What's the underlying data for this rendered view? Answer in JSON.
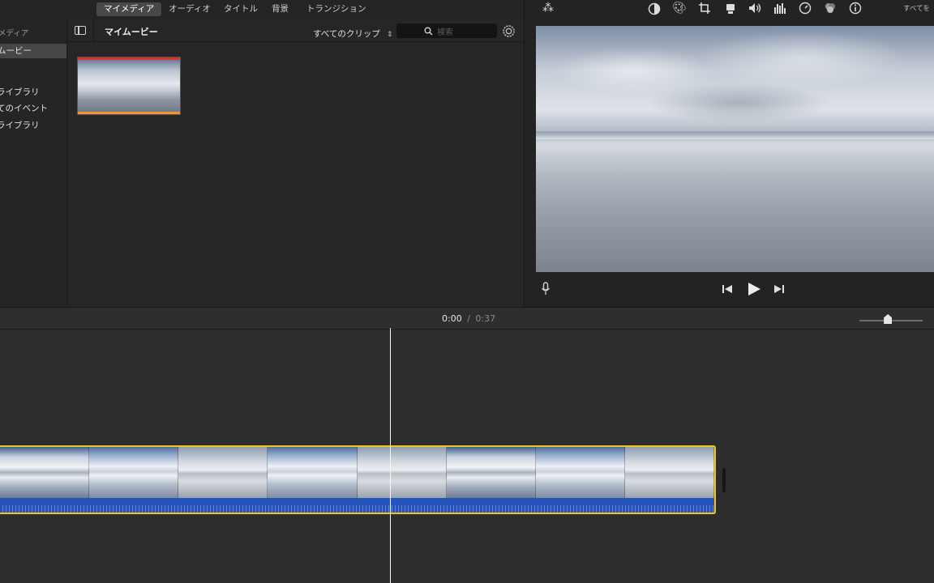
{
  "tabs": [
    {
      "label": "マイメディア",
      "active": true
    },
    {
      "label": "オーディオ",
      "active": false
    },
    {
      "label": "タイトル",
      "active": false
    },
    {
      "label": "背景",
      "active": false
    },
    {
      "label": "トランジション",
      "active": false
    }
  ],
  "sidebar": {
    "section_label": "メディア",
    "items": [
      {
        "label": "ムービー",
        "selected": true
      },
      {
        "label": "ライブラリ"
      },
      {
        "label": "てのイベント"
      },
      {
        "label": "ライブラリ"
      }
    ]
  },
  "browser": {
    "title": "マイムービー",
    "filter": "すべてのクリップ",
    "search_placeholder": "検索"
  },
  "viewer": {
    "toolbar_right_text": "すべてを"
  },
  "timeline": {
    "current_time": "0:00",
    "separator": "/",
    "total_time": "0:37",
    "zoom_level": 0.45
  },
  "colors": {
    "clip_border": "#f0c419",
    "audio_waveform": "#2754b8",
    "thumb_top_bar": "#e0302f",
    "thumb_bottom_bar": "#f3942e"
  }
}
